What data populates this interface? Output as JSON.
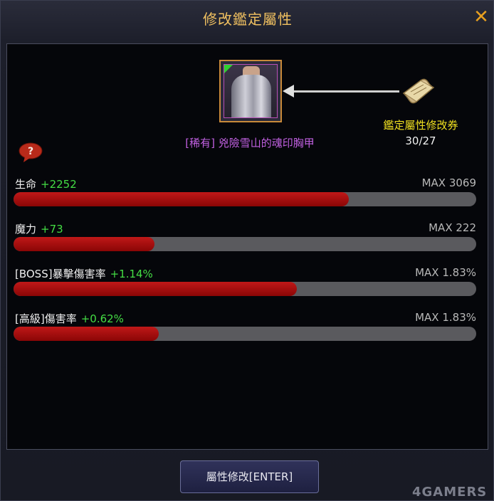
{
  "window": {
    "title": "修改鑑定屬性",
    "close_label": "✕"
  },
  "item": {
    "name": "[稀有] 兇險雪山的魂印胸甲",
    "icon": "chest-armor-icon"
  },
  "coupon": {
    "label": "鑑定屬性修改券",
    "count": "30/27",
    "icon": "scroll-icon"
  },
  "help": {
    "label": "?"
  },
  "stats": [
    {
      "name": "生命",
      "bonus": "+2252",
      "max": "MAX 3069",
      "fill": 0.725
    },
    {
      "name": "魔力",
      "bonus": "+73",
      "max": "MAX 222",
      "fill": 0.305
    },
    {
      "name": "[BOSS]暴擊傷害率",
      "bonus": "+1.14%",
      "max": "MAX 1.83%",
      "fill": 0.612
    },
    {
      "name": "[高級]傷害率",
      "bonus": "+0.62%",
      "max": "MAX 1.83%",
      "fill": 0.314
    }
  ],
  "confirm_button": {
    "label": "屬性修改[ENTER]"
  },
  "watermark": "4GAMERS",
  "colors": {
    "title": "#f0c060",
    "item_name": "#c060e0",
    "coupon_label": "#f0e020",
    "bonus": "#44dd44",
    "bar_fill": "#b01010",
    "bar_track": "#5a5a5e"
  }
}
